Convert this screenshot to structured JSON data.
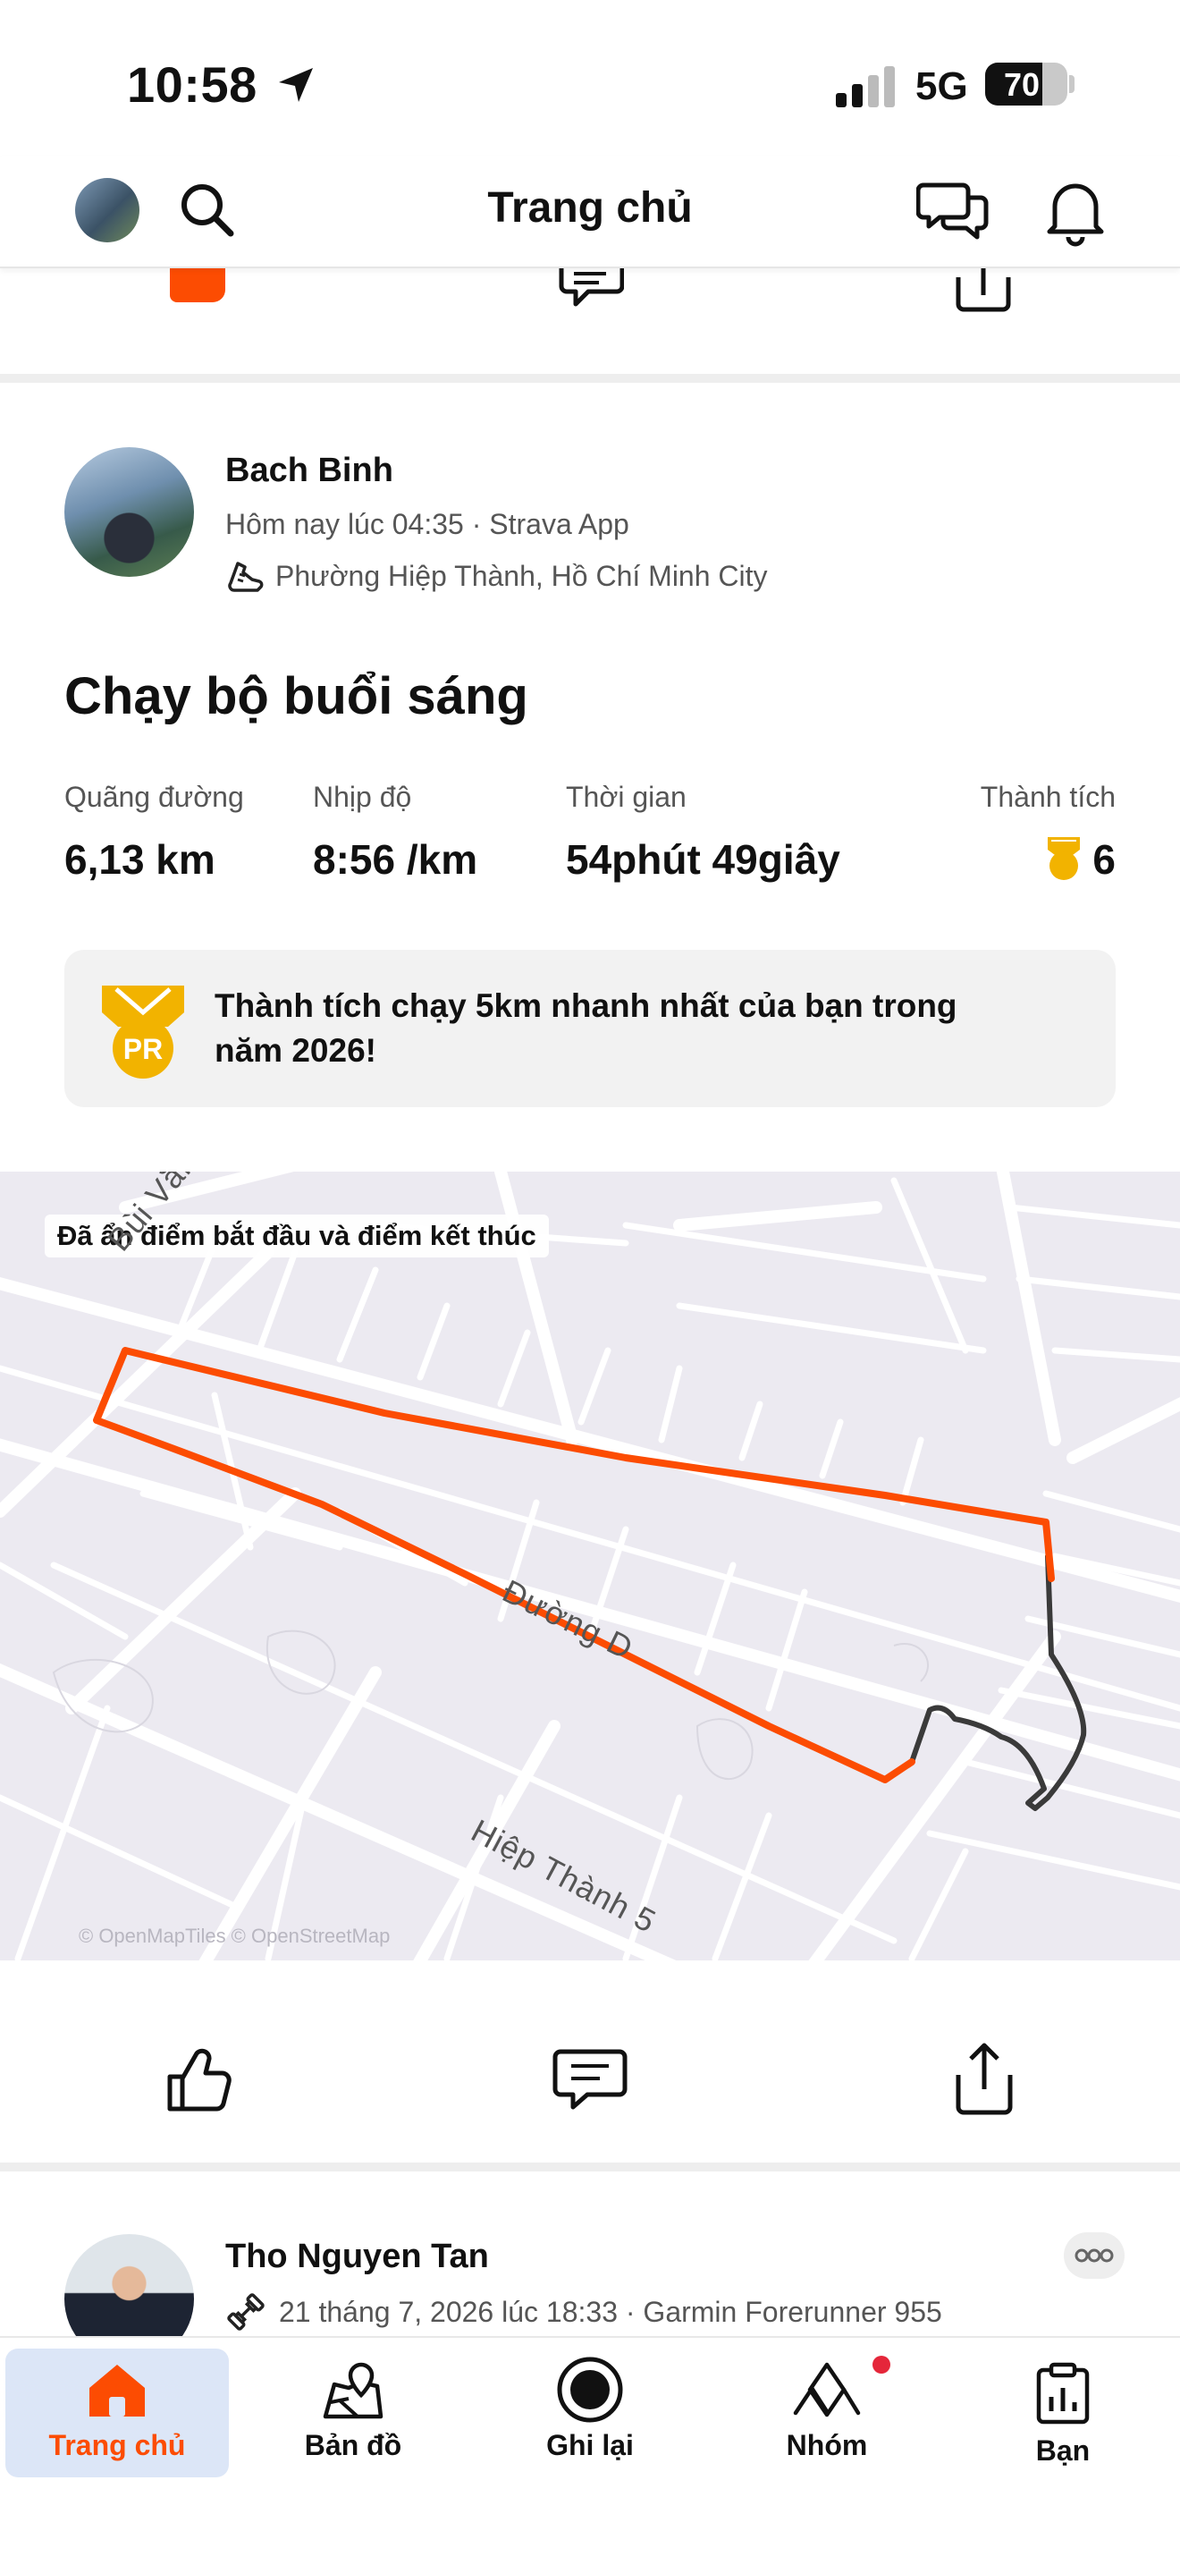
{
  "status_bar": {
    "time": "10:58",
    "network": "5G",
    "battery_level": 70,
    "battery_text": "70"
  },
  "header": {
    "title": "Trang chủ",
    "icons": [
      "avatar",
      "search-icon",
      "chat-icon",
      "bell-icon"
    ]
  },
  "activity": {
    "athlete_name": "Bach Binh",
    "timestamp": "Hôm nay lúc 04:35 · Strava App",
    "location": "Phường Hiệp Thành, Hồ Chí Minh City",
    "title": "Chạy bộ buổi sáng",
    "stats": [
      {
        "label": "Quãng đường",
        "value": "6,13 km"
      },
      {
        "label": "Nhịp độ",
        "value": "8:56 /km"
      },
      {
        "label": "Thời gian",
        "value": "54phút 49giây"
      },
      {
        "label": "Thành tích",
        "value": "6"
      }
    ],
    "pr_message": "Thành tích chạy 5km nhanh nhất của bạn trong năm 2026!",
    "pr_badge": "PR",
    "map": {
      "hidden_points_note": "Đã ẩn điểm bắt đầu và điểm kết thúc",
      "street_labels": [
        "Bùi Văn Ngữ",
        "Đường D",
        "Hiệp Thành 5"
      ],
      "attribution": "© OpenMapTiles © OpenStreetMap",
      "route_color": "#fc4c02",
      "hidden_route_color": "#3a3a3a"
    }
  },
  "next_activity": {
    "athlete_name": "Tho Nguyen Tan",
    "timestamp": "21 tháng 7, 2026 lúc 18:33 · Garmin Forerunner 955"
  },
  "bottom_nav": {
    "tabs": [
      {
        "label": "Trang chủ",
        "icon": "home-icon",
        "active": true
      },
      {
        "label": "Bản đồ",
        "icon": "map-icon",
        "active": false
      },
      {
        "label": "Ghi lại",
        "icon": "record-icon",
        "active": false
      },
      {
        "label": "Nhóm",
        "icon": "groups-icon",
        "active": false,
        "notification": true
      },
      {
        "label": "Bạn",
        "icon": "you-icon",
        "active": false
      }
    ]
  },
  "colors": {
    "brand": "#fc4c02",
    "gold": "#f2b300",
    "active_tab_bg": "#dce6f7"
  }
}
